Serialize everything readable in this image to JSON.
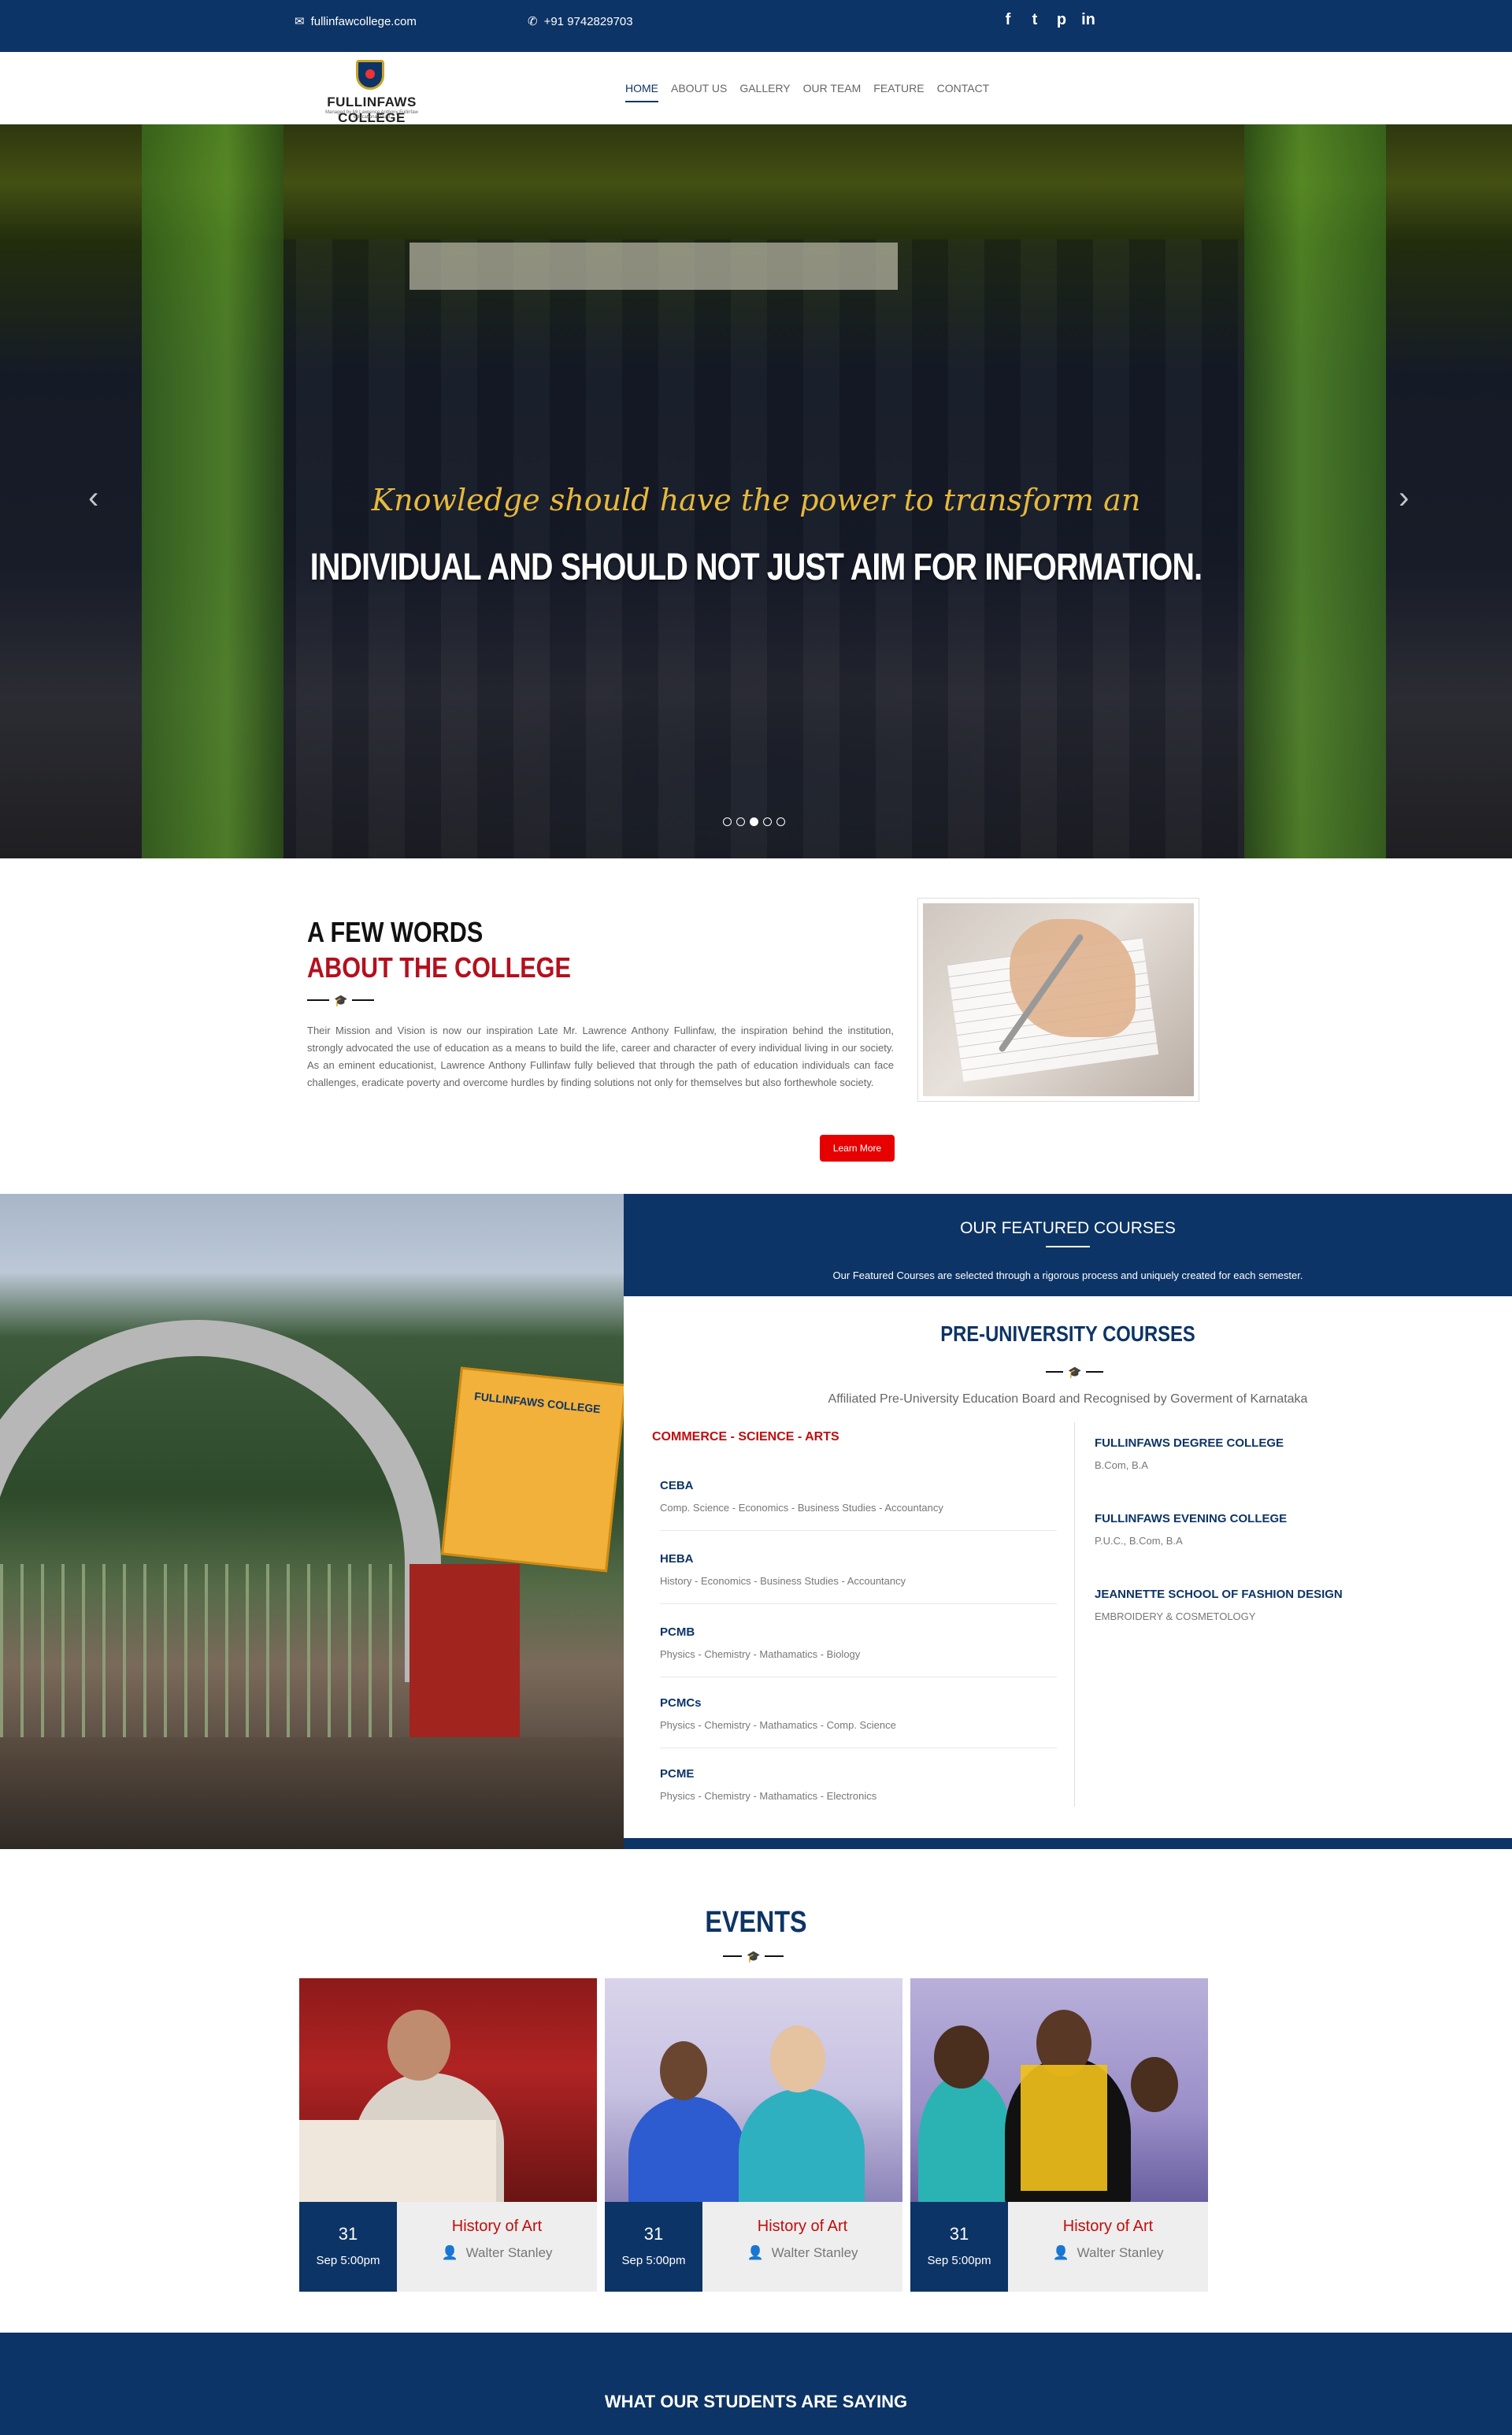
{
  "topbar": {
    "email": "fullinfawcollege.com",
    "phone": "+91 9742829703",
    "social": [
      {
        "name": "facebook-icon",
        "glyph": "f"
      },
      {
        "name": "twitter-icon",
        "glyph": "t"
      },
      {
        "name": "pinterest-icon",
        "glyph": "p"
      },
      {
        "name": "linkedin-icon",
        "glyph": "in"
      }
    ]
  },
  "brand": {
    "name": "FULLINFAWS COLLEGE",
    "tagline": "Managed by Mr.Lawrence Anthony Fullinfaw Educational Trust"
  },
  "nav": [
    "HOME",
    "ABOUT US",
    "GALLERY",
    "OUR TEAM",
    "FEATURE",
    "CONTACT"
  ],
  "hero": {
    "quote": "Knowledge should have the power to transform an",
    "title": "INDIVIDUAL AND SHOULD NOT JUST AIM FOR INFORMATION.",
    "slides": 5,
    "active_slide": 3
  },
  "about": {
    "heading1": "A FEW WORDS",
    "heading2": "ABOUT THE COLLEGE",
    "text": "Their Mission and Vision is now our inspiration Late Mr. Lawrence Anthony Fullinfaw, the inspiration behind the institution, strongly advocated the use of education as a means to build the life, career and character of every individual living in our society. As an eminent educationist, Lawrence Anthony Fullinfaw fully believed that through the path of education individuals can face challenges, eradicate poverty and overcome hurdles by finding solutions not only for themselves but also forthewhole society.",
    "button": "Learn More"
  },
  "featured": {
    "title": "OUR FEATURED COURSES",
    "subtitle": "Our Featured Courses are selected through a rigorous process and uniquely created for each semester.",
    "card_title": "PRE-UNIVERSITY COURSES",
    "card_sub": "Affiliated Pre-University Education Board and Recognised by Goverment of Karnataka",
    "category": "COMMERCE - SCIENCE - ARTS",
    "courses": [
      {
        "name": "CEBA",
        "subjects": "Comp. Science - Economics - Business Studies - Accountancy"
      },
      {
        "name": "HEBA",
        "subjects": "History - Economics - Business Studies - Accountancy"
      },
      {
        "name": "PCMB",
        "subjects": "Physics - Chemistry - Mathamatics - Biology"
      },
      {
        "name": "PCMCs",
        "subjects": "Physics - Chemistry - Mathamatics - Comp. Science"
      },
      {
        "name": "PCME",
        "subjects": "Physics - Chemistry - Mathamatics - Electronics"
      }
    ],
    "colleges": [
      {
        "name": "FULLINFAWS DEGREE COLLEGE",
        "detail": "B.Com, B.A"
      },
      {
        "name": "FULLINFAWS EVENING COLLEGE",
        "detail": "P.U.C., B.Com, B.A"
      },
      {
        "name": "JEANNETTE SCHOOL OF FASHION DESIGN",
        "detail": "EMBROIDERY & COSMETOLOGY"
      }
    ],
    "campus_sign": "FULLINFAWS COLLEGE"
  },
  "events": {
    "title": "EVENTS",
    "items": [
      {
        "day": "31",
        "time": "Sep 5:00pm",
        "title": "History of Art",
        "speaker": "Walter Stanley"
      },
      {
        "day": "31",
        "time": "Sep 5:00pm",
        "title": "History of Art",
        "speaker": "Walter Stanley"
      },
      {
        "day": "31",
        "time": "Sep 5:00pm",
        "title": "History of Art",
        "speaker": "Walter Stanley"
      }
    ]
  },
  "testimonials": {
    "title": "WHAT OUR STUDENTS ARE SAYING"
  },
  "colors": {
    "primary": "#0d3466",
    "accent": "#b50f1e",
    "button": "#e60000",
    "quote": "#e7b93c"
  }
}
